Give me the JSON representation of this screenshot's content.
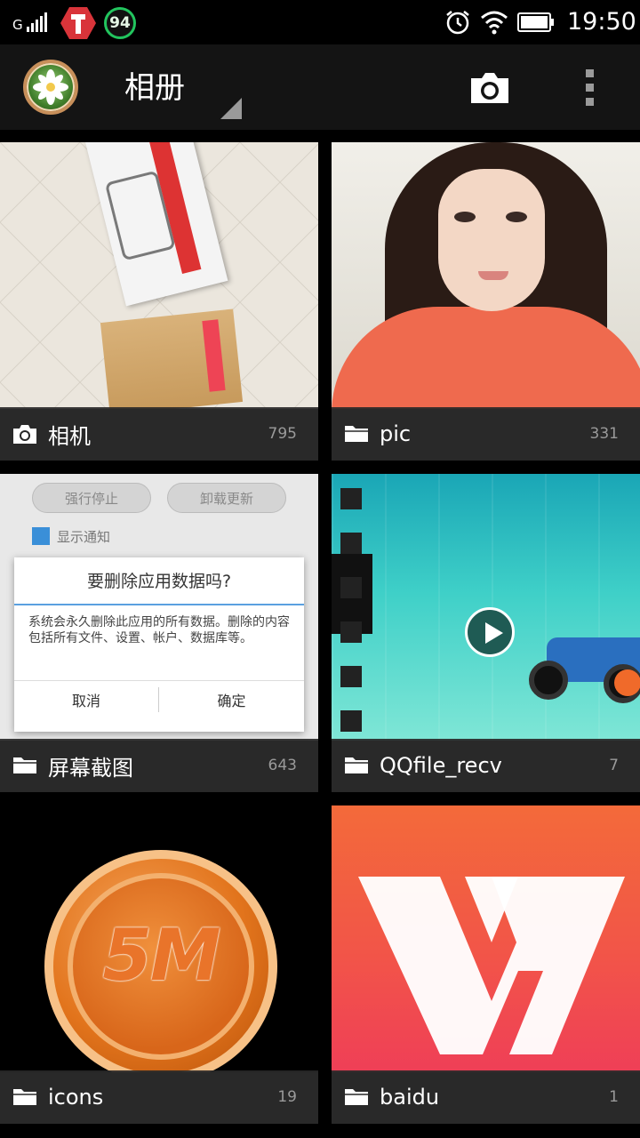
{
  "status_bar": {
    "network": "G",
    "battery_app_value": "94",
    "time": "19:50"
  },
  "action_bar": {
    "title": "相册"
  },
  "albums": [
    {
      "name": "相机",
      "count": "795",
      "icon": "camera-icon"
    },
    {
      "name": "pic",
      "count": "331",
      "icon": "folder-icon"
    },
    {
      "name": "屏幕截图",
      "count": "643",
      "icon": "folder-icon"
    },
    {
      "name": "QQfile_recv",
      "count": "7",
      "icon": "folder-icon"
    },
    {
      "name": "icons",
      "count": "19",
      "icon": "folder-icon"
    },
    {
      "name": "baidu",
      "count": "1",
      "icon": "folder-icon"
    }
  ],
  "screenshot_thumb": {
    "btn_left": "强行停止",
    "btn_right": "卸载更新",
    "checkbox_label": "显示通知",
    "dialog_title": "要删除应用数据吗?",
    "dialog_message": "系统会永久删除此应用的所有数据。删除的内容包括所有文件、设置、帐户、数据库等。",
    "dialog_cancel": "取消",
    "dialog_ok": "确定"
  },
  "icons_thumb": {
    "coin_text": "5M"
  },
  "colors": {
    "background": "#000000",
    "label_bar": "#282828",
    "count_text": "#9a9a9a",
    "baidu_gradient_top": "#f36a3a",
    "baidu_gradient_bottom": "#ef3f57",
    "coin_orange": "#e2741c"
  }
}
